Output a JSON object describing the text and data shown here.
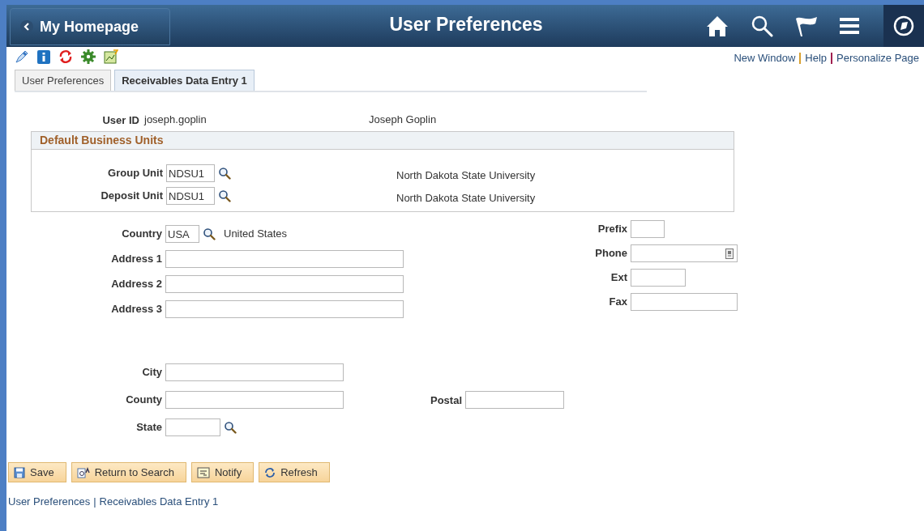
{
  "header": {
    "back": "My Homepage",
    "title": "User Preferences"
  },
  "top_links": [
    "New Window",
    "Help",
    "Personalize Page"
  ],
  "tabs": [
    {
      "label": "User Preferences",
      "selected": false
    },
    {
      "label": "Receivables Data Entry 1",
      "selected": true
    }
  ],
  "user": {
    "label": "User ID",
    "value": "joseph.goplin",
    "name": "Joseph Goplin"
  },
  "business_units": {
    "title": "Default Business Units",
    "rows": [
      {
        "label": "Group Unit",
        "value": "NDSU1",
        "description": "North Dakota State University"
      },
      {
        "label": "Deposit Unit",
        "value": "NDSU1",
        "description": "North Dakota State University"
      }
    ]
  },
  "country": {
    "label": "Country",
    "value": "USA",
    "description": "United States"
  },
  "address_fields": [
    {
      "label": "Address 1"
    },
    {
      "label": "Address 2"
    },
    {
      "label": "Address 3"
    }
  ],
  "phone_fields": [
    {
      "label": "Prefix",
      "kind": "short"
    },
    {
      "label": "Phone",
      "kind": "phone"
    },
    {
      "label": "Ext",
      "kind": "medium"
    },
    {
      "label": "Fax",
      "kind": "long"
    }
  ],
  "city": {
    "label": "City"
  },
  "county": {
    "label": "County"
  },
  "postal": {
    "label": "Postal"
  },
  "state": {
    "label": "State"
  },
  "buttons": [
    {
      "label": "Save",
      "kind": "save"
    },
    {
      "label": "Return to Search",
      "kind": "search"
    },
    {
      "label": "Notify",
      "kind": "notify"
    },
    {
      "label": "Refresh",
      "kind": "refresh"
    }
  ],
  "footer_links": [
    "User Preferences",
    "Receivables Data Entry 1"
  ],
  "footer_separator": "|"
}
